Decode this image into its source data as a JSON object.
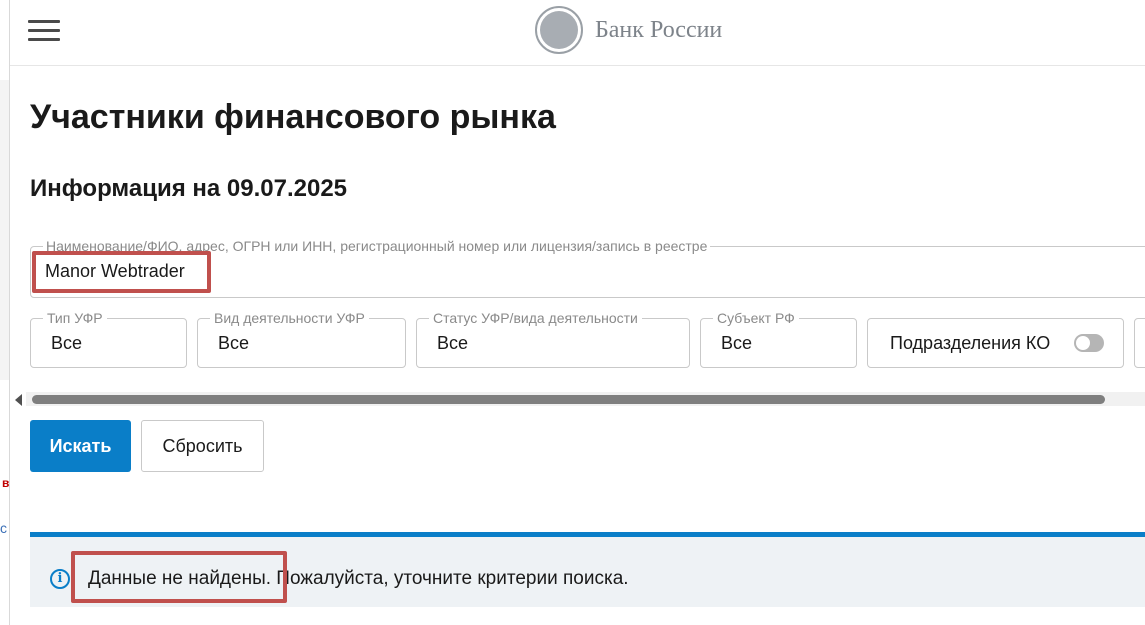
{
  "header": {
    "menu_icon": "hamburger-menu-icon",
    "logo_emblem": "double-headed-eagle-emblem-icon",
    "logo_text": "Банк России"
  },
  "page": {
    "title": "Участники финансового рынка",
    "info_date": "Информация на 09.07.2025"
  },
  "search": {
    "legend": "Наименование/ФИО, адрес, ОГРН или ИНН, регистрационный номер или лицензия/запись в реестре",
    "value": "Manor Webtrader"
  },
  "filters": [
    {
      "legend": "Тип УФР",
      "value": "Все"
    },
    {
      "legend": "Вид деятельности УФР",
      "value": "Все"
    },
    {
      "legend": "Статус УФР/вида деятельности",
      "value": "Все"
    },
    {
      "legend": "Субъект РФ",
      "value": "Все"
    }
  ],
  "branches_toggle": {
    "label": "Подразделения КО",
    "checked": false
  },
  "buttons": {
    "search_label": "Искать",
    "reset_label": "Сбросить"
  },
  "alert": {
    "icon": "info-icon",
    "text": "Данные не найдены. Пожалуйста, уточните критерии поиска."
  },
  "colors": {
    "accent": "#0a7ec8",
    "alert_background": "#eef2f5",
    "highlight_border": "#c0504d"
  }
}
